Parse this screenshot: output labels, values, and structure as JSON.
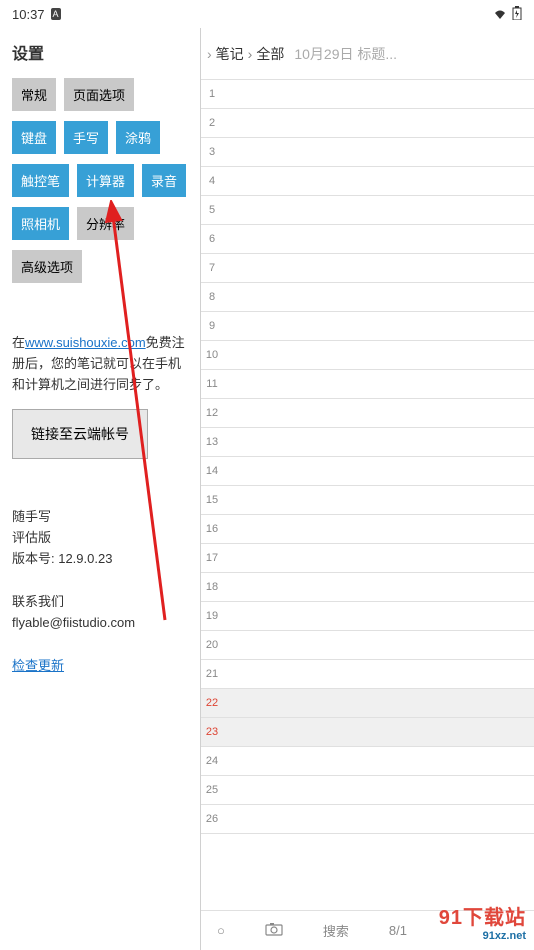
{
  "status": {
    "time": "10:37",
    "indicator": "A"
  },
  "sidebar": {
    "title": "设置",
    "r1": {
      "general": "常规",
      "page_options": "页面选项"
    },
    "r2": {
      "keyboard": "键盘",
      "handwrite": "手写",
      "doodle": "涂鸦"
    },
    "r3": {
      "stylus": "触控笔",
      "calculator": "计算器",
      "record": "录音"
    },
    "r4": {
      "camera": "照相机",
      "resolution": "分辨率"
    },
    "r5": {
      "advanced": "高级选项"
    },
    "info_prefix": "在",
    "info_url": "www.suishouxie.com",
    "info_suffix": "免费注册后，您的笔记就可以在手机和计算机之间进行同步了。",
    "cloud_btn": "链接至云端帐号",
    "app_name": "随手写",
    "app_edition": "评估版",
    "app_version": "版本号: 12.9.0.23",
    "contact_label": "联系我们",
    "contact_email": "flyable@fiistudio.com",
    "check_update": "检查更新"
  },
  "breadcrumb": {
    "notes": "笔记",
    "all": "全部",
    "detail": "10月29日 标题..."
  },
  "lines": [
    1,
    2,
    3,
    4,
    5,
    6,
    7,
    8,
    9,
    10,
    11,
    12,
    13,
    14,
    15,
    16,
    17,
    18,
    19,
    20,
    21,
    22,
    23,
    24,
    25,
    26
  ],
  "highlight": [
    22,
    23
  ],
  "bottombar": {
    "circle": "○",
    "camera": "⎙",
    "search": "搜索",
    "page": "8/1"
  },
  "watermark": {
    "top": "91下载站",
    "bot": "91xz.net"
  }
}
